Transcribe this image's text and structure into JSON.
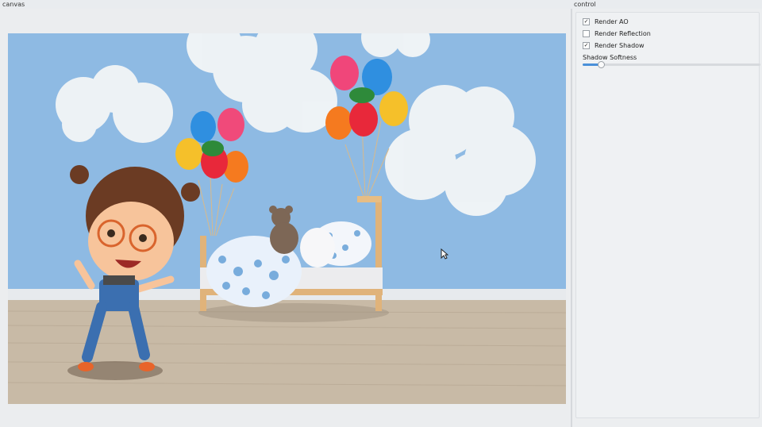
{
  "panels": {
    "canvas_label": "canvas",
    "control_label": "control"
  },
  "controls": {
    "checkboxes": [
      {
        "label": "Render AO",
        "checked": true
      },
      {
        "label": "Render Reflection",
        "checked": false
      },
      {
        "label": "Render Shadow",
        "checked": true
      }
    ],
    "slider": {
      "label": "Shadow Softness",
      "value": 0.1
    }
  },
  "colors": {
    "accent": "#4a90d9",
    "wall": "#8ebae3",
    "floor": "#c4b6a3"
  }
}
